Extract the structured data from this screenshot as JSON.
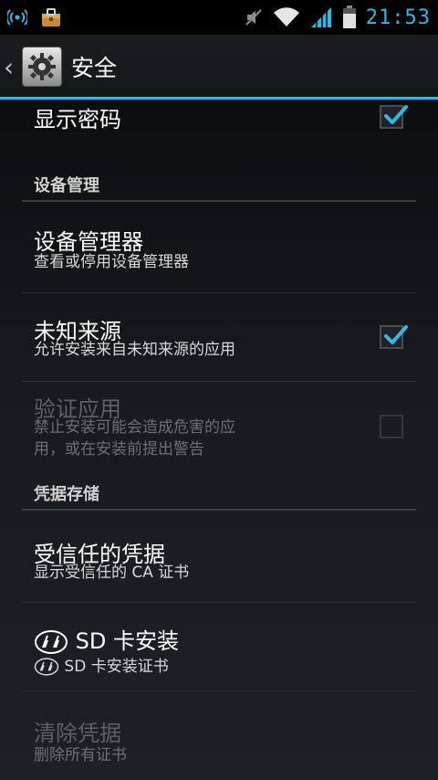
{
  "statusbar": {
    "left_icons": [
      "wireless-icon",
      "toolbox-icon"
    ],
    "right_icons": [
      "mute-icon",
      "wifi-icon",
      "signal-icon",
      "battery-icon"
    ],
    "time": "21:53",
    "accent": "#33b5e5"
  },
  "actionbar": {
    "title": "安全",
    "icon": "settings-gear-icon"
  },
  "prefs": {
    "show_password": {
      "title": "显示密码",
      "checked": true
    },
    "cat_device_admin": "设备管理",
    "device_admins": {
      "title": "设备管理器",
      "summary": "查看或停用设备管理器"
    },
    "unknown_sources": {
      "title": "未知来源",
      "summary": "允许安装来自未知来源的应用",
      "checked": true
    },
    "verify_apps": {
      "title": "验证应用",
      "summary_line1": "禁止安装可能会造成危害的应",
      "summary_line2": "用，或在安装前提出警告",
      "checked": false,
      "enabled": false
    },
    "cat_credential_storage": "凭据存储",
    "trusted_credentials": {
      "title": "受信任的凭据",
      "summary": "显示受信任的 CA 证书"
    },
    "sd_install": {
      "title": "SD 卡安装",
      "summary": "SD 卡安装证书"
    },
    "clear_credentials": {
      "title": "清除凭据",
      "summary": "删除所有证书",
      "enabled": false
    }
  }
}
